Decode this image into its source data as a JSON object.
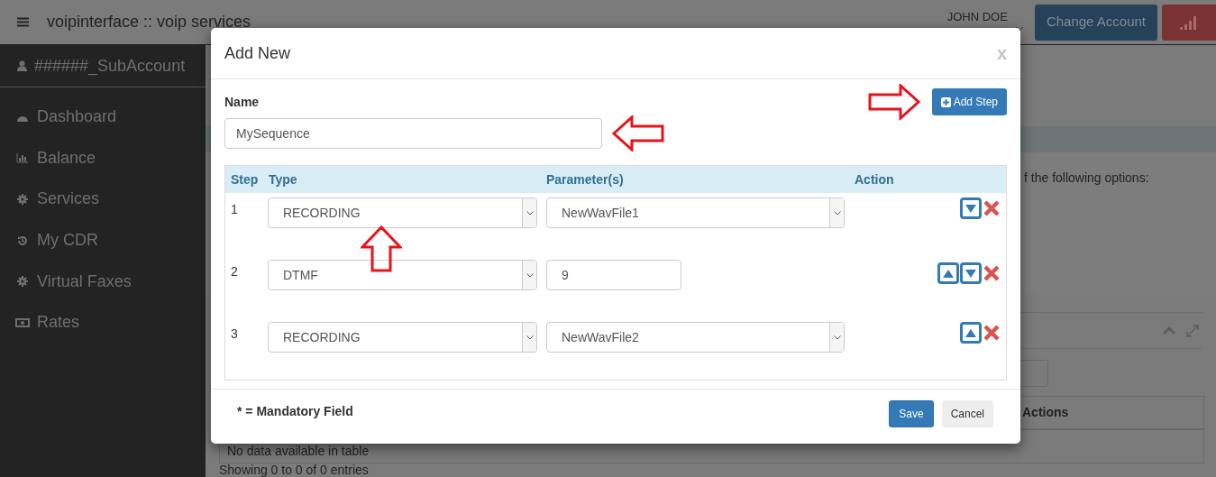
{
  "header": {
    "title": "voipinterface :: voip services",
    "user_name": "JOHN DOE",
    "change_account": "Change Account"
  },
  "sidebar": {
    "account": "######_SubAccount",
    "items": [
      {
        "label": "Dashboard",
        "kind": "dashboard"
      },
      {
        "label": "Balance",
        "kind": "chart"
      },
      {
        "label": "Services",
        "kind": "gear"
      },
      {
        "label": "My CDR",
        "kind": "history"
      },
      {
        "label": "Virtual Faxes",
        "kind": "gear"
      },
      {
        "label": "Rates",
        "kind": "money"
      }
    ]
  },
  "background": {
    "options_text": "f the following options:",
    "table_header": "Actions",
    "empty_text": "No data available in table",
    "info_text": "Showing 0 to 0 of 0 entries"
  },
  "modal": {
    "title": "Add New",
    "close": "x",
    "name_label": "Name",
    "name_value": "MySequence",
    "add_step": "Add Step",
    "columns": [
      "Step",
      "Type",
      "Parameter(s)",
      "Action"
    ],
    "rows": [
      {
        "step": "1",
        "type": "RECORDING",
        "param": "NewWavFile1",
        "kind": "select",
        "can_move_up": false,
        "can_move_down": true
      },
      {
        "step": "2",
        "type": "DTMF",
        "param": "9",
        "kind": "input",
        "can_move_up": true,
        "can_move_down": true
      },
      {
        "step": "3",
        "type": "RECORDING",
        "param": "NewWavFile2",
        "kind": "select",
        "can_move_up": true,
        "can_move_down": false
      }
    ],
    "mandatory_note": "* = Mandatory Field",
    "save": "Save",
    "cancel": "Cancel"
  }
}
